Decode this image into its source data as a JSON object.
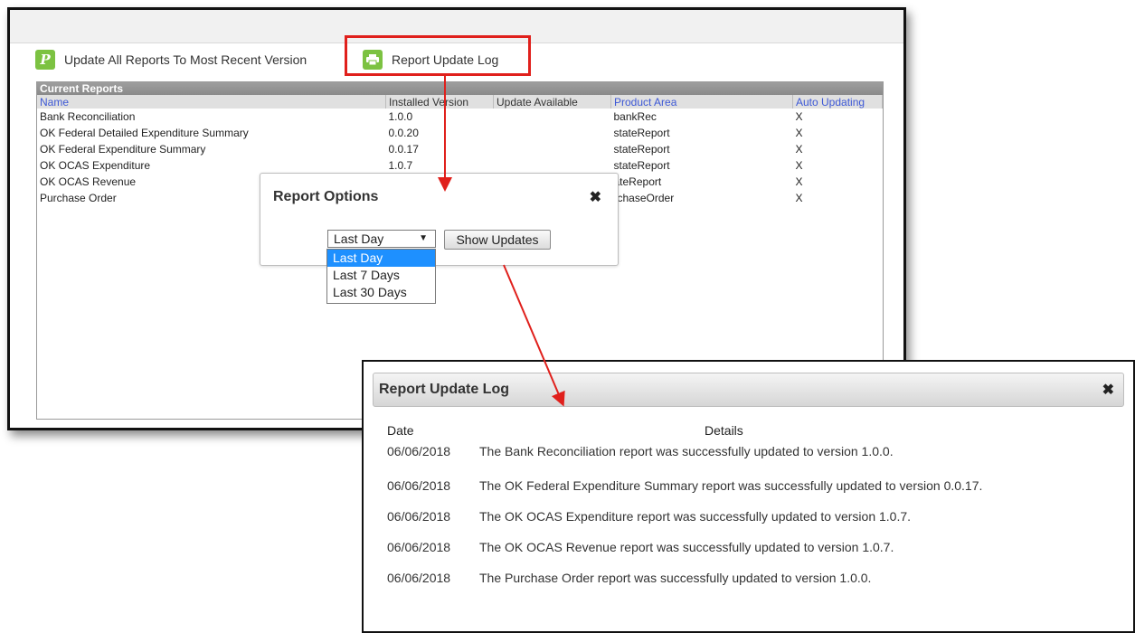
{
  "toolbar": {
    "update_all_label": "Update All Reports To Most Recent Version",
    "report_log_label": "Report Update Log"
  },
  "reports_panel": {
    "title": "Current Reports",
    "columns": [
      "Name",
      "Installed Version",
      "Update Available",
      "Product Area",
      "Auto Updating"
    ],
    "rows": [
      [
        "Bank Reconciliation",
        "1.0.0",
        "",
        "bankRec",
        "X"
      ],
      [
        "OK Federal Detailed Expenditure Summary",
        "0.0.20",
        "",
        "stateReport",
        "X"
      ],
      [
        "OK Federal Expenditure Summary",
        "0.0.17",
        "",
        "stateReport",
        "X"
      ],
      [
        "OK OCAS Expenditure",
        "1.0.7",
        "",
        "stateReport",
        "X"
      ],
      [
        "OK OCAS Revenue",
        "",
        "",
        "ateReport",
        "X"
      ],
      [
        "Purchase Order",
        "",
        "",
        "rchaseOrder",
        "X"
      ]
    ]
  },
  "report_options": {
    "title": "Report Options",
    "close": "✖",
    "selected_range": "Last Day",
    "options": [
      "Last Day",
      "Last 7 Days",
      "Last 30 Days"
    ],
    "show_updates_label": "Show Updates"
  },
  "update_log": {
    "title": "Report Update Log",
    "close": "✖",
    "date_header": "Date",
    "details_header": "Details",
    "entries": [
      {
        "date": "06/06/2018",
        "details": "The Bank Reconciliation report was successfully updated to version 1.0.0."
      },
      {
        "date": "06/06/2018",
        "details": "The OK Federal Expenditure Summary report was successfully updated to version 0.0.17."
      },
      {
        "date": "06/06/2018",
        "details": "The OK OCAS Expenditure report was successfully updated to version 1.0.7."
      },
      {
        "date": "06/06/2018",
        "details": "The OK OCAS Revenue report was successfully updated to version 1.0.7."
      },
      {
        "date": "06/06/2018",
        "details": "The Purchase Order report was successfully updated to version 1.0.0."
      }
    ]
  },
  "colors": {
    "annotation_red": "#e0201c",
    "icon_green": "#7cc242",
    "link_blue": "#3d58d6",
    "dropdown_highlight": "#1e90ff"
  }
}
